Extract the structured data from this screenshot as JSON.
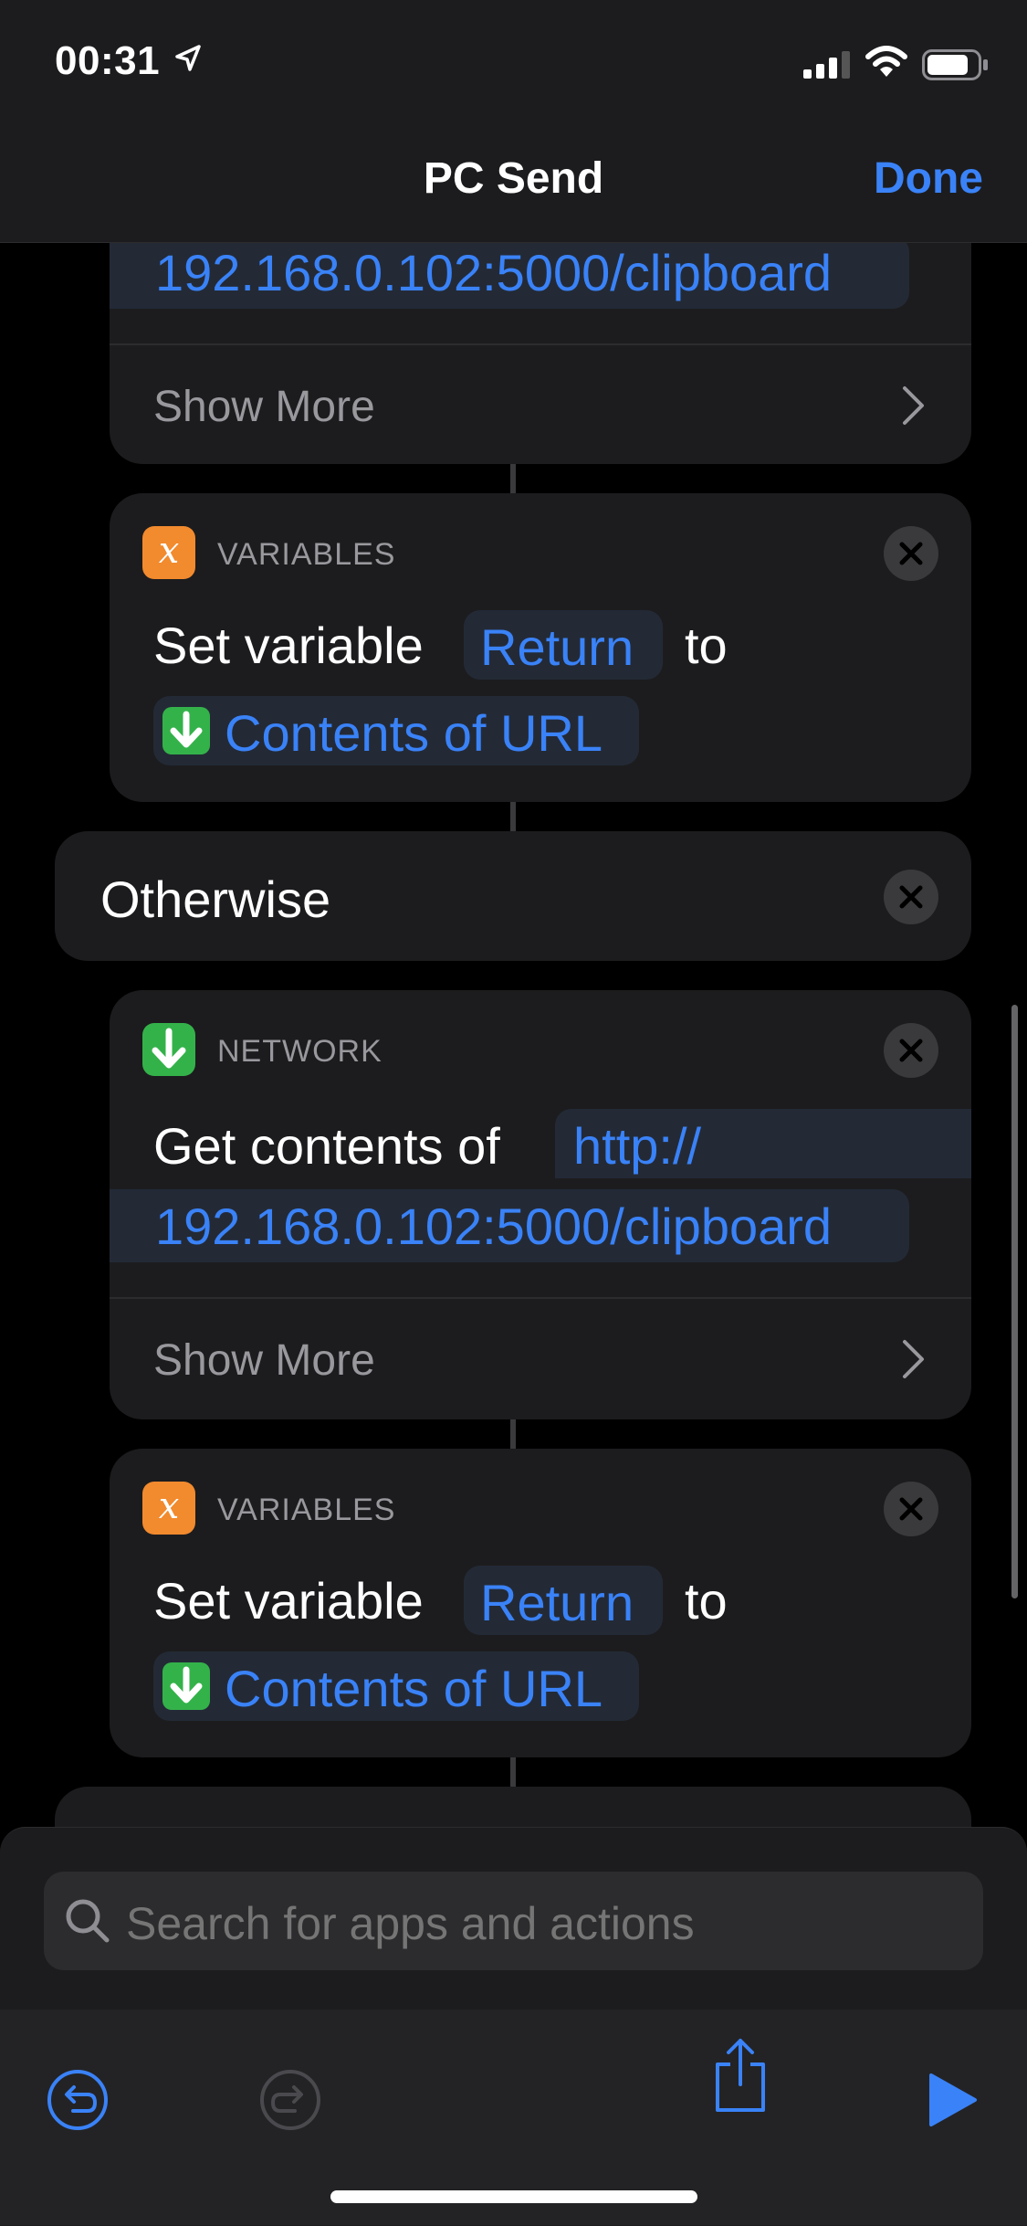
{
  "status_bar": {
    "time": "00:31"
  },
  "nav": {
    "title": "PC Send",
    "done_label": "Done"
  },
  "top_partial": {
    "url_line": "192.168.0.102:5000/clipboard",
    "show_more": "Show More"
  },
  "variables_1": {
    "category": "VARIABLES",
    "text_prefix": "Set variable",
    "variable": "Return",
    "text_to": "to",
    "value": "Contents of URL"
  },
  "otherwise": {
    "label": "Otherwise"
  },
  "network": {
    "category": "NETWORK",
    "text_prefix": "Get contents of",
    "url_line1": "http://",
    "url_line2": "192.168.0.102:5000/clipboard",
    "show_more": "Show More"
  },
  "variables_2": {
    "category": "VARIABLES",
    "text_prefix": "Set variable",
    "variable": "Return",
    "text_to": "to",
    "value": "Contents of URL"
  },
  "search": {
    "placeholder": "Search for apps and actions"
  },
  "colors": {
    "accent": "#3a82f7",
    "variables": "#f28a2e",
    "network": "#34b24a"
  },
  "icons": [
    "location-arrow-icon",
    "signal-icon",
    "wifi-icon",
    "battery-icon",
    "variables-x-icon",
    "download-arrow-icon",
    "close-icon",
    "chevron-right-icon",
    "search-icon",
    "undo-icon",
    "redo-icon",
    "share-icon",
    "play-icon"
  ]
}
